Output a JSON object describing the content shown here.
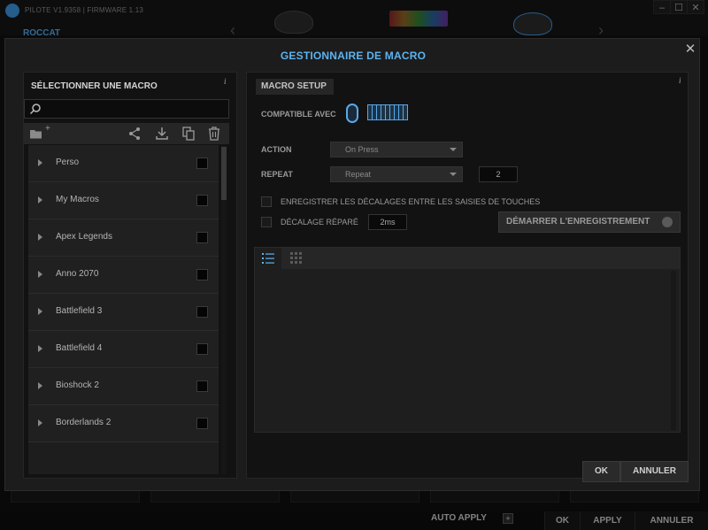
{
  "app": {
    "title": "PILOTE V1.9358 | FIRMWARE 1.13",
    "brand": "ROCCAT",
    "window_controls": [
      "–",
      "☐",
      "✕"
    ]
  },
  "footer_bar": {
    "auto_apply_label": "AUTO APPLY",
    "auto_apply_toggle": "+",
    "ok_label": "OK",
    "apply_label": "APPLY",
    "cancel_label": "ANNULER"
  },
  "modal": {
    "title": "GESTIONNAIRE DE MACRO",
    "close_icon": "close-icon",
    "left": {
      "title": "SÉLECTIONNER UNE MACRO",
      "info": "i",
      "search_placeholder": "",
      "toolbar_icons": [
        "new-folder-icon",
        "share-icon",
        "download-icon",
        "copy-icon",
        "trash-icon"
      ],
      "folder_plus": "+",
      "macros": [
        {
          "name": "Perso"
        },
        {
          "name": "My Macros"
        },
        {
          "name": "Apex Legends"
        },
        {
          "name": "Anno 2070"
        },
        {
          "name": "Battlefield 3"
        },
        {
          "name": "Battlefield 4"
        },
        {
          "name": "Bioshock 2"
        },
        {
          "name": "Borderlands 2"
        }
      ]
    },
    "right": {
      "title": "MACRO SETUP",
      "info": "i",
      "compatible_label": "COMPATIBLE AVEC",
      "action_label": "ACTION",
      "action_value": "On Press",
      "repeat_label": "REPEAT",
      "repeat_value": "Repeat",
      "repeat_count": "2",
      "record_delays_label": "ENREGISTRER LES DÉCALAGES ENTRE LES SAISIES DE TOUCHES",
      "fixed_delay_label": "DÉCALAGE RÉPARÉ",
      "fixed_delay_value": "2ms",
      "start_record_label": "DÉMARRER L'ENREGISTREMENT",
      "editor_tabs": [
        "list-view-icon",
        "grid-view-icon"
      ]
    },
    "ok_label": "OK",
    "cancel_label": "ANNULER"
  },
  "colors": {
    "accent": "#5cb3f0",
    "panel": "#121212",
    "modal": "#1c1c1c"
  }
}
